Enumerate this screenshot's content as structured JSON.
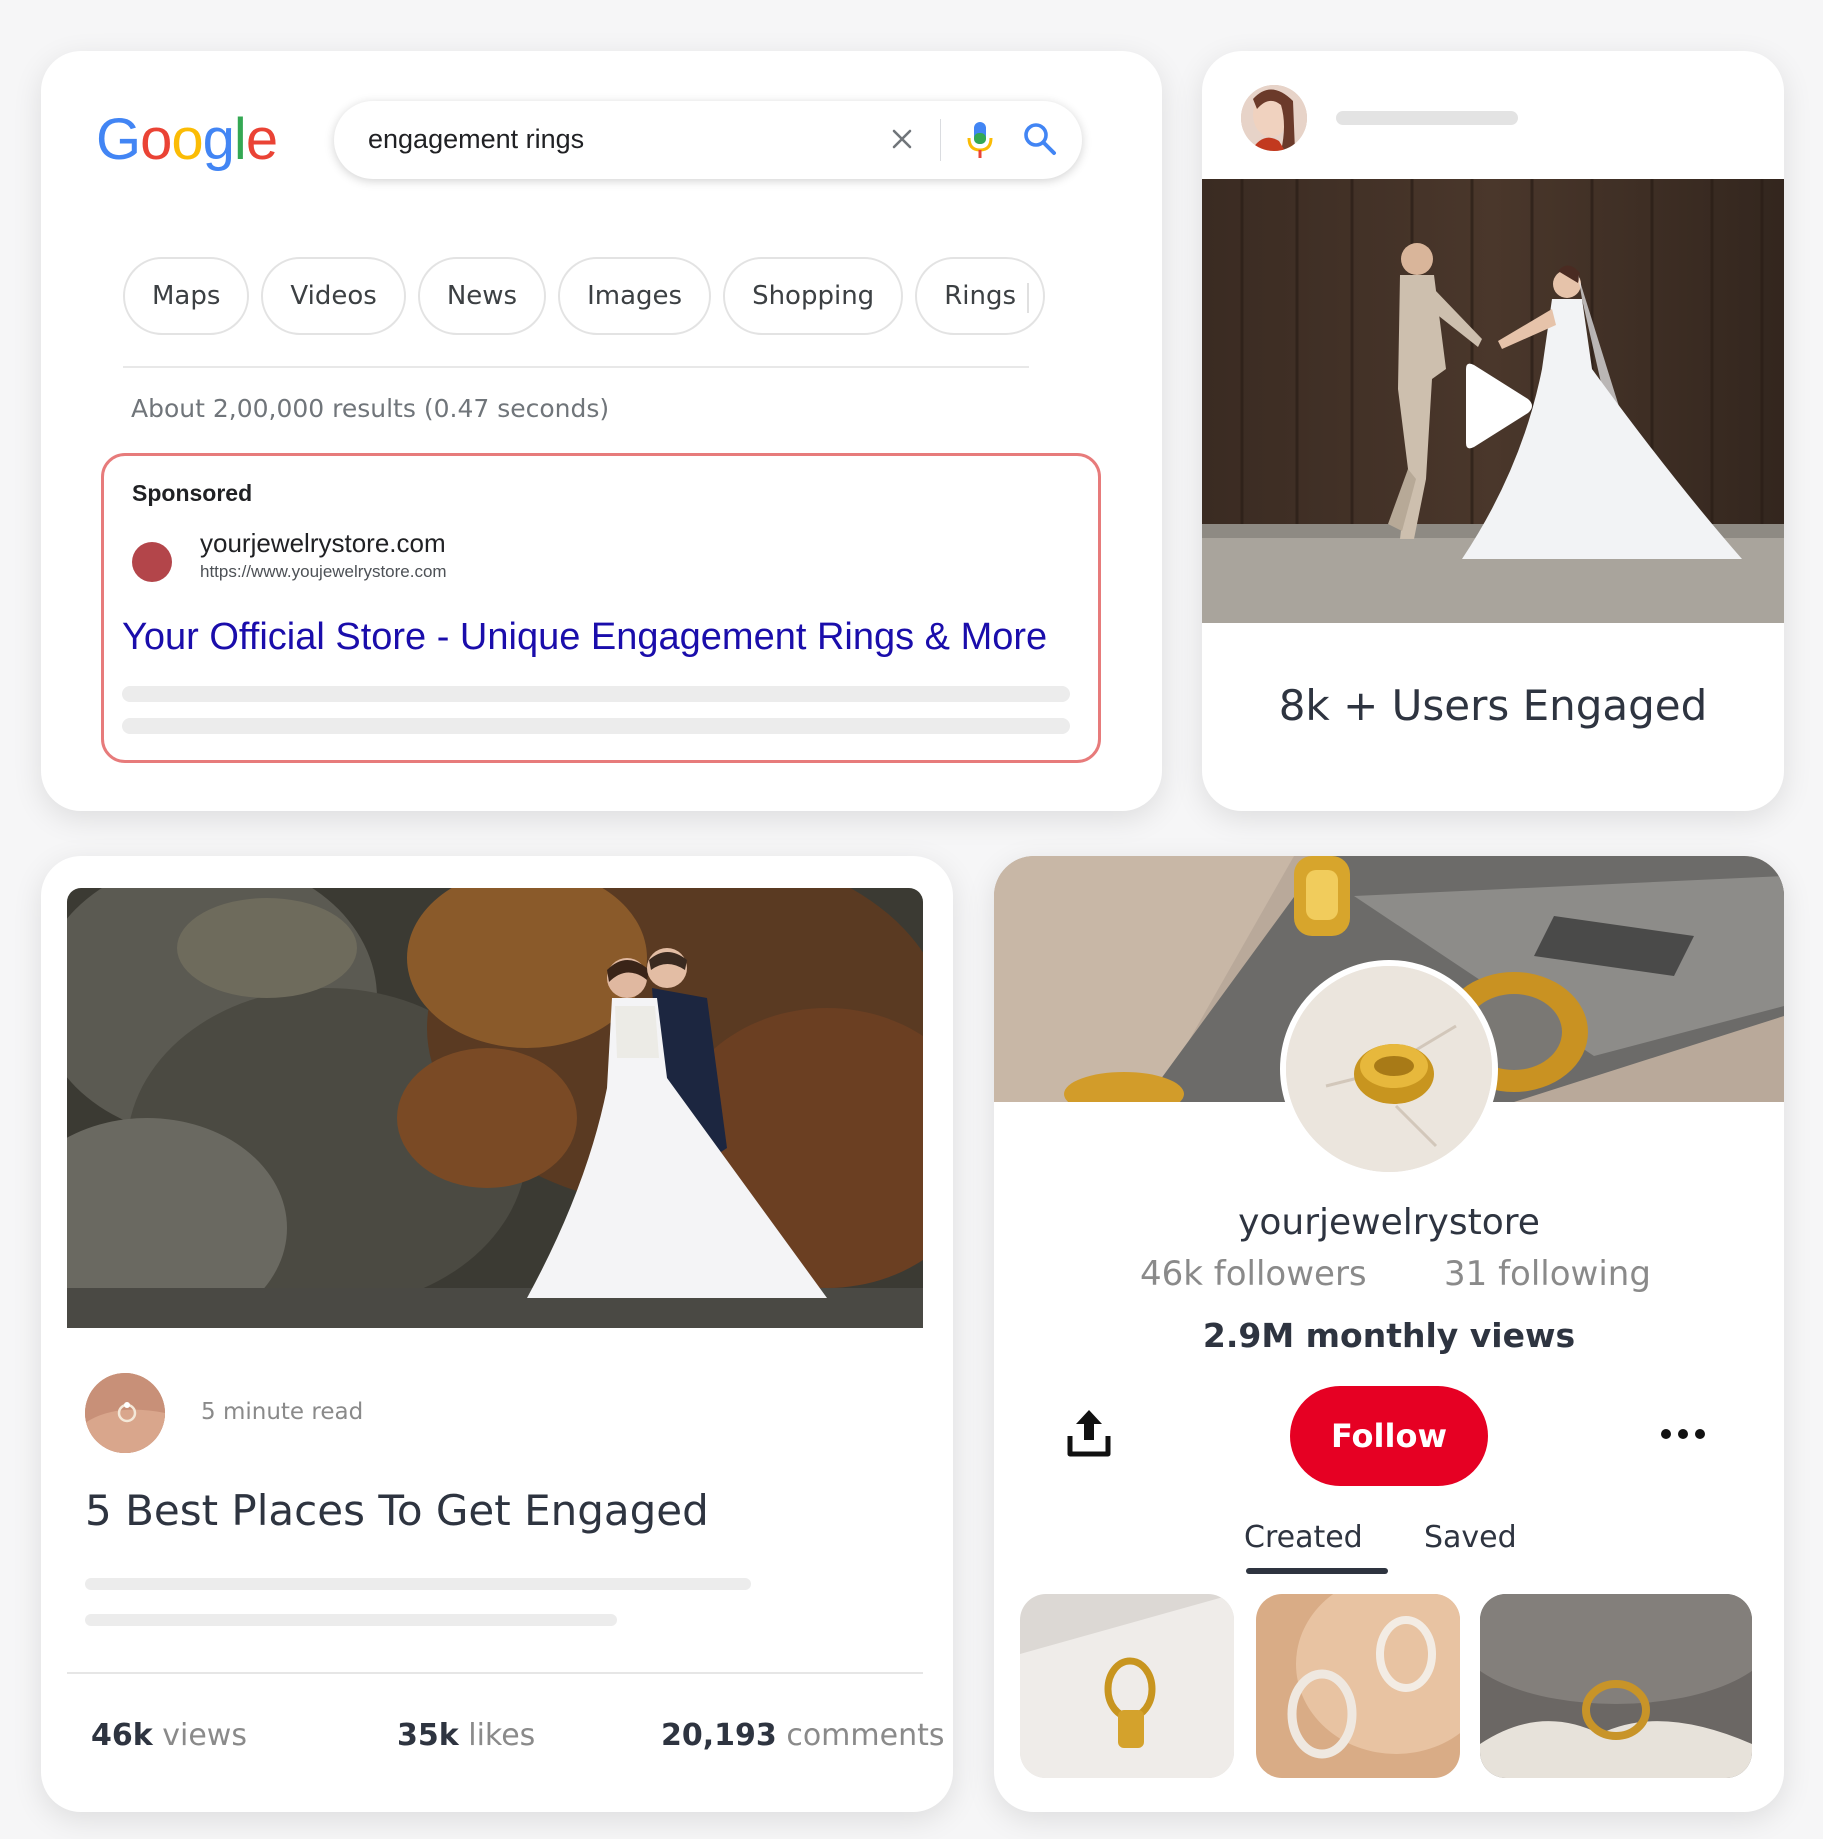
{
  "search_card": {
    "logo_text": "Google",
    "query": "engagement rings",
    "chips": [
      "Maps",
      "Videos",
      "News",
      "Images",
      "Shopping",
      "Rings"
    ],
    "results_count": "About 2,00,000 results (0.47 seconds)",
    "ad": {
      "label": "Sponsored",
      "domain": "yourjewelrystore.com",
      "url": "https://www.youjewelrystore.com",
      "title": "Your Official Store - Unique Engagement Rings & More",
      "favicon_color": "#b3454a",
      "border_color": "#e77b7b",
      "title_color": "#1a0dab"
    }
  },
  "video_card": {
    "caption": "8k + Users Engaged",
    "play_icon": "play-icon"
  },
  "blog_card": {
    "read_time": "5 minute read",
    "title": "5 Best Places To Get Engaged",
    "stats": [
      {
        "value": "46k",
        "label": "views"
      },
      {
        "value": "35k",
        "label": "likes"
      },
      {
        "value": "20,193",
        "label": "comments"
      }
    ]
  },
  "profile_card": {
    "username": "yourjewelrystore",
    "followers": "46k followers",
    "following": "31 following",
    "monthly_views": "2.9M monthly views",
    "follow_label": "Follow",
    "follow_color": "#e60023",
    "tabs": [
      "Created",
      "Saved"
    ],
    "active_tab": "Created"
  }
}
